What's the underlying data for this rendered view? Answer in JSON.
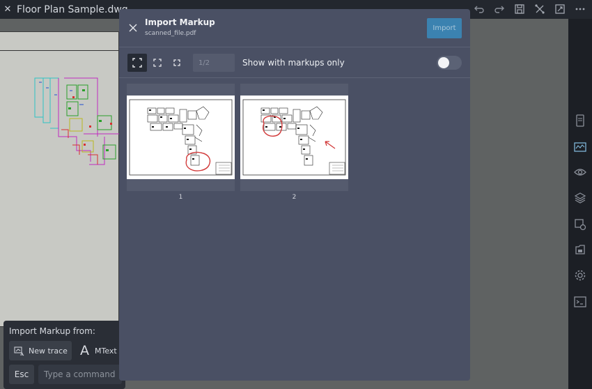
{
  "app": {
    "doc_title": "Floor Plan Sample.dwg",
    "top_icons": [
      "undo-icon",
      "redo-icon",
      "save-icon",
      "markup-icon",
      "fullscreen-icon",
      "more-icon"
    ],
    "rail_icons": [
      "sheet-icon",
      "markup-list-icon",
      "visibility-icon",
      "layers-icon",
      "properties-icon",
      "blocks-icon",
      "settings-icon",
      "console-icon"
    ]
  },
  "command_panel": {
    "title": "Import Markup from:",
    "new_trace_label": "New trace",
    "mtext_glyph": "A",
    "mtext_label": "MText",
    "esc_label": "Esc",
    "command_placeholder": "Type a command"
  },
  "modal": {
    "title": "Import Markup",
    "subtitle": "scanned_file.pdf",
    "import_label": "Import",
    "page_indicator": "1/2",
    "toggle_label": "Show with markups only",
    "toggle_on": false,
    "pages": [
      {
        "label": "1"
      },
      {
        "label": "2"
      }
    ]
  },
  "colors": {
    "modal_bg": "#4a5064",
    "accent": "#3b82b0",
    "markup_red": "#d23a3a"
  }
}
